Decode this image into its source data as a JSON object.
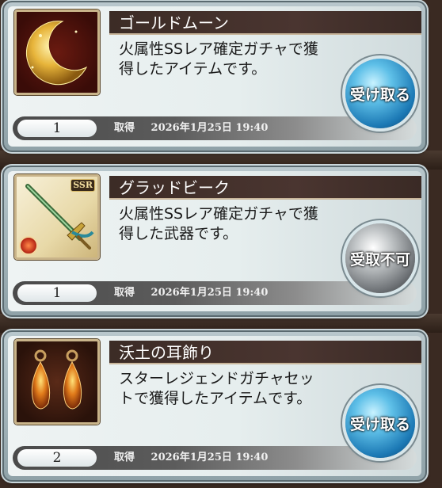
{
  "items": [
    {
      "name": "ゴールドムーン",
      "description": "火属性SSレア確定ガチャで獲得したアイテムです。",
      "count": "1",
      "acquired_label": "取得",
      "acquired_date": "2026年1月25日 19:40",
      "button_label": "受け取る",
      "button_state": "enabled",
      "icon": "gold-moon-icon"
    },
    {
      "name": "グラッドビーク",
      "description": "火属性SSレア確定ガチャで獲得した武器です。",
      "count": "1",
      "acquired_label": "取得",
      "acquired_date": "2026年1月25日 19:40",
      "button_label": "受取不可",
      "button_state": "disabled",
      "rarity_badge": "SSR",
      "icon": "sword-icon"
    },
    {
      "name": "沃土の耳飾り",
      "description": "スターレジェンドガチャセットで獲得したアイテムです。",
      "count": "2",
      "acquired_label": "取得",
      "acquired_date": "2026年1月25日 19:40",
      "button_label": "受け取る",
      "button_state": "enabled",
      "icon": "earrings-icon"
    }
  ],
  "colors": {
    "button_blue": "#1b78b4",
    "button_gray": "#6e7276",
    "title_bar": "#3c2c26"
  }
}
